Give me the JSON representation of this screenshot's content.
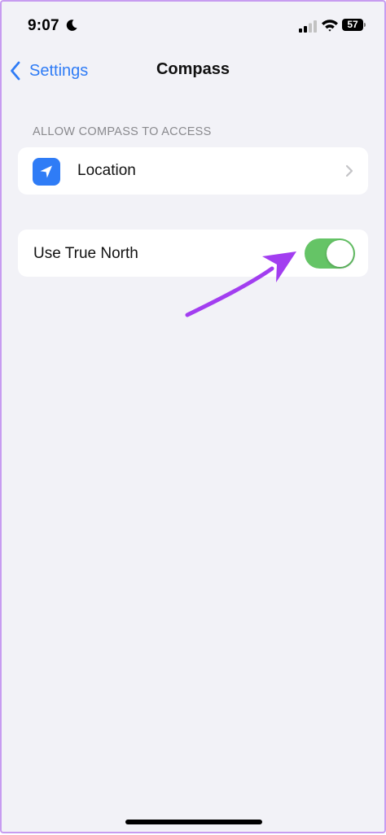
{
  "status_bar": {
    "time": "9:07",
    "battery_level": "57",
    "icons": [
      "moon-icon",
      "signal-icon",
      "wifi-icon",
      "battery-icon"
    ]
  },
  "nav": {
    "back_label": "Settings",
    "title": "Compass"
  },
  "sections": {
    "access_header": "ALLOW COMPASS TO ACCESS",
    "location": {
      "label": "Location",
      "icon": "location-arrow-icon"
    },
    "true_north": {
      "label": "Use True North",
      "toggle_on": true
    }
  },
  "colors": {
    "accent": "#2f7cf6",
    "toggle_on": "#65c466",
    "background": "#f2f2f7",
    "annotation_arrow": "#a23ef0"
  }
}
